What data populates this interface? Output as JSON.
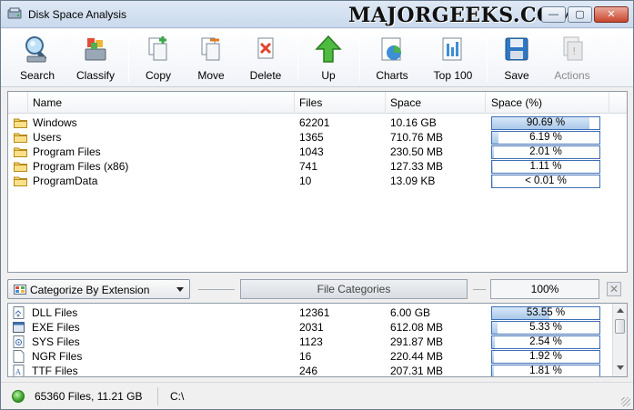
{
  "window": {
    "title": "Disk Space Analysis",
    "watermark": "MAJORGEEKS.COM",
    "controls": {
      "minimize": "—",
      "maximize": "▢",
      "close": "✕"
    }
  },
  "toolbar": {
    "search": "Search",
    "classify": "Classify",
    "copy": "Copy",
    "move": "Move",
    "delete": "Delete",
    "up": "Up",
    "charts": "Charts",
    "top100": "Top 100",
    "save": "Save",
    "actions": "Actions"
  },
  "columns": {
    "name": "Name",
    "files": "Files",
    "space": "Space",
    "space_pct": "Space (%)"
  },
  "folders": [
    {
      "name": "Windows",
      "files": "62201",
      "space": "10.16 GB",
      "pct_label": "90.69 %",
      "pct": 90.69
    },
    {
      "name": "Users",
      "files": "1365",
      "space": "710.76 MB",
      "pct_label": "6.19 %",
      "pct": 6.19
    },
    {
      "name": "Program Files",
      "files": "1043",
      "space": "230.50 MB",
      "pct_label": "2.01 %",
      "pct": 2.01
    },
    {
      "name": "Program Files (x86)",
      "files": "741",
      "space": "127.33 MB",
      "pct_label": "1.11 %",
      "pct": 1.11
    },
    {
      "name": "ProgramData",
      "files": "10",
      "space": "13.09 KB",
      "pct_label": "< 0.01 %",
      "pct": 0.01
    }
  ],
  "category_bar": {
    "dropdown_value": "Categorize By Extension",
    "file_categories_button": "File Categories",
    "total_pct": "100%",
    "close": "✕"
  },
  "categories": [
    {
      "name": "DLL Files",
      "files": "12361",
      "space": "6.00 GB",
      "pct_label": "53.55 %",
      "pct": 53.55,
      "icon": "dll-file-icon"
    },
    {
      "name": "EXE Files",
      "files": "2031",
      "space": "612.08 MB",
      "pct_label": "5.33 %",
      "pct": 5.33,
      "icon": "exe-file-icon"
    },
    {
      "name": "SYS Files",
      "files": "1123",
      "space": "291.87 MB",
      "pct_label": "2.54 %",
      "pct": 2.54,
      "icon": "sys-file-icon"
    },
    {
      "name": "NGR Files",
      "files": "16",
      "space": "220.44 MB",
      "pct_label": "1.92 %",
      "pct": 1.92,
      "icon": "blank-file-icon"
    },
    {
      "name": "TTF Files",
      "files": "246",
      "space": "207.31 MB",
      "pct_label": "1.81 %",
      "pct": 1.81,
      "icon": "font-file-icon"
    }
  ],
  "status": {
    "summary": "65360 Files, 11.21 GB",
    "path": "C:\\"
  }
}
